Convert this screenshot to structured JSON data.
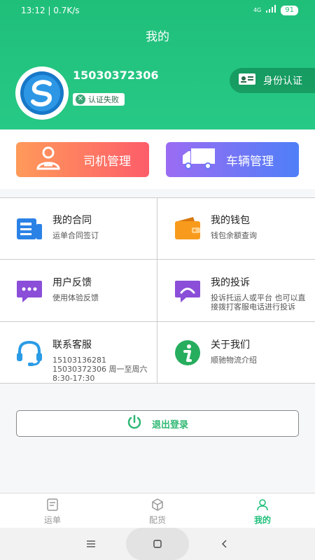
{
  "status_bar": {
    "time": "13:12 | 0.7K/s",
    "signal": "4G",
    "battery": "91"
  },
  "header": {
    "title": "我的"
  },
  "profile": {
    "phone": "15030372306",
    "auth_status": "认证失败",
    "id_auth_label": "身份认证"
  },
  "actions": {
    "driver_manage": "司机管理",
    "vehicle_manage": "车辆管理"
  },
  "grid": [
    {
      "title": "我的合同",
      "subtitle": "运单合同签订"
    },
    {
      "title": "我的钱包",
      "subtitle": "钱包余额查询"
    },
    {
      "title": "用户反馈",
      "subtitle": "使用体验反馈"
    },
    {
      "title": "我的投诉",
      "subtitle": "投诉托运人或平台 也可以直接拨打客服电话进行投诉"
    },
    {
      "title": "联系客服",
      "subtitle": "15103136281 15030372306 周一至周六8:30-17:30"
    },
    {
      "title": "关于我们",
      "subtitle": "顺驰物流介绍"
    }
  ],
  "logout": {
    "label": "退出登录"
  },
  "tabs": [
    {
      "label": "运单"
    },
    {
      "label": "配货"
    },
    {
      "label": "我的"
    }
  ],
  "colors": {
    "accent": "#1fbf7a",
    "driver_grad": "#fd5d6a",
    "vehicle_grad": "#4f7ff8"
  }
}
